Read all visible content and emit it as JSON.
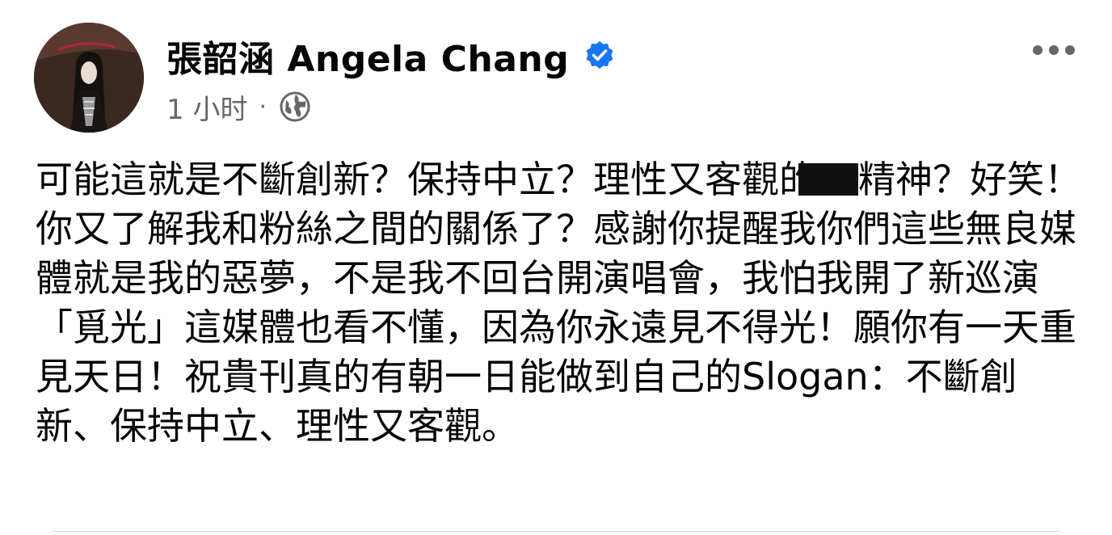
{
  "author": {
    "name": "張韶涵 Angela Chang",
    "verified": true
  },
  "meta": {
    "time": "1 小时",
    "separator": "·",
    "audience_icon": "globe-icon"
  },
  "actions": {
    "more_icon": "more-options-icon"
  },
  "post": {
    "text_before_redaction": "可能這就是不斷創新？保持中立？理性又客觀的",
    "text_after_redaction": "精神？好笑！你又了解我和粉絲之間的關係了？感謝你提醒我你們這些無良媒體就是我的惡夢，不是我不回台開演唱會，我怕我開了新巡演「覓光」這媒體也看不懂，因為你永遠見不得光！願你有一天重見天日！祝貴刊真的有朝一日能做到自己的Slogan：不斷創新、保持中立、理性又客觀。"
  },
  "colors": {
    "verified_blue": "#1877f2",
    "secondary_text": "#65676b",
    "primary_text": "#050505"
  }
}
